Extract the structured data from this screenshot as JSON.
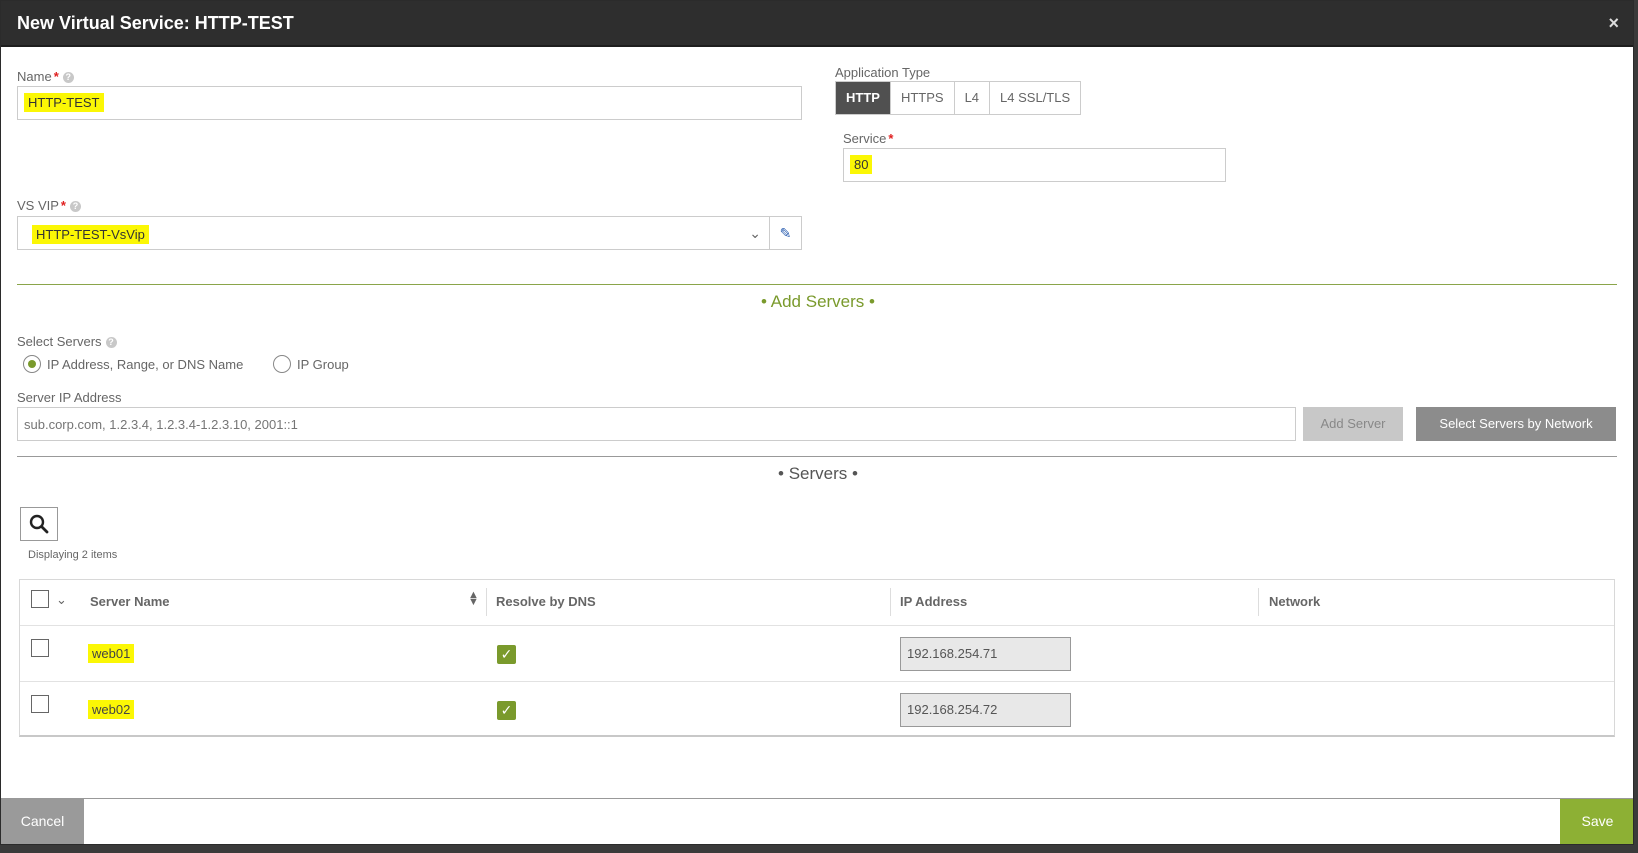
{
  "modal": {
    "title": "New Virtual Service: HTTP-TEST",
    "close_icon": "×"
  },
  "name": {
    "label": "Name",
    "required_mark": "*",
    "value": "HTTP-TEST"
  },
  "application_type": {
    "label": "Application Type",
    "options": [
      "HTTP",
      "HTTPS",
      "L4",
      "L4 SSL/TLS"
    ],
    "selected": "HTTP"
  },
  "service": {
    "label": "Service",
    "required_mark": "*",
    "value": "80"
  },
  "vs_vip": {
    "label": "VS VIP",
    "required_mark": "*",
    "value": "HTTP-TEST-VsVip"
  },
  "add_servers": {
    "section_title": "• Add Servers •",
    "select_label": "Select Servers",
    "radio_options": [
      "IP Address, Range, or DNS Name",
      "IP Group"
    ],
    "server_ip_label": "Server IP Address",
    "server_ip_placeholder": "sub.corp.com, 1.2.3.4, 1.2.3.4-1.2.3.10, 2001::1",
    "add_server_button": "Add Server",
    "select_by_network_button": "Select Servers by Network"
  },
  "servers": {
    "section_title": "• Servers •",
    "display_count": "Displaying 2 items",
    "columns": [
      "Server Name",
      "Resolve by DNS",
      "IP Address",
      "Network"
    ],
    "rows": [
      {
        "name": "web01",
        "resolve_by_dns": true,
        "ip": "192.168.254.71",
        "network": ""
      },
      {
        "name": "web02",
        "resolve_by_dns": true,
        "ip": "192.168.254.72",
        "network": ""
      }
    ]
  },
  "footer": {
    "cancel": "Cancel",
    "save": "Save"
  },
  "colors": {
    "accent_green": "#8db034",
    "highlight": "#fbf705",
    "titlebar": "#2e2e2e"
  }
}
